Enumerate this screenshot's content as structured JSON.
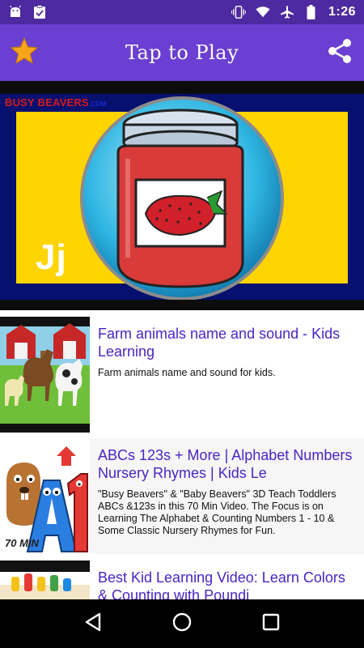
{
  "status_bar": {
    "time": "1:26",
    "left_icons": [
      "android-icon",
      "clipboard-check-icon"
    ],
    "right_icons": [
      "vibrate-icon",
      "wifi-icon",
      "airplane-icon",
      "battery-icon"
    ]
  },
  "app_bar": {
    "title": "Tap to Play",
    "favorite_icon": "star-icon",
    "share_icon": "share-icon",
    "color": "#6a3fd1",
    "status_color": "#4d2a9f"
  },
  "hero": {
    "brand_main": "BUSY BEAVERS",
    "brand_domain": ".COM",
    "letter": "Jj"
  },
  "videos": [
    {
      "title": "Farm animals name and sound - Kids Learning",
      "description": "Farm animals name and sound for kids."
    },
    {
      "title": "ABCs 123s + More | Alphabet Numbers Nursery Rhymes | Kids Le",
      "description": "\"Busy Beavers\" & \"Baby Beavers\" 3D Teach Toddlers ABCs &123s in this 70 Min Video. The Focus is on Learning The Alphabet & Counting Numbers 1 - 10 & Some Classic Nursery Rhymes for Fun.",
      "thumb_badge": "70 MIN"
    },
    {
      "title": "Best Kid Learning Video: Learn Colors & Counting with Poundi",
      "description": ""
    }
  ],
  "nav": {
    "back_icon": "back-icon",
    "home_icon": "home-icon",
    "recents_icon": "recents-icon"
  },
  "colors": {
    "title_purple": "#4a24c4",
    "hero_blue": "#06106e",
    "hero_yellow": "#ffd400"
  }
}
